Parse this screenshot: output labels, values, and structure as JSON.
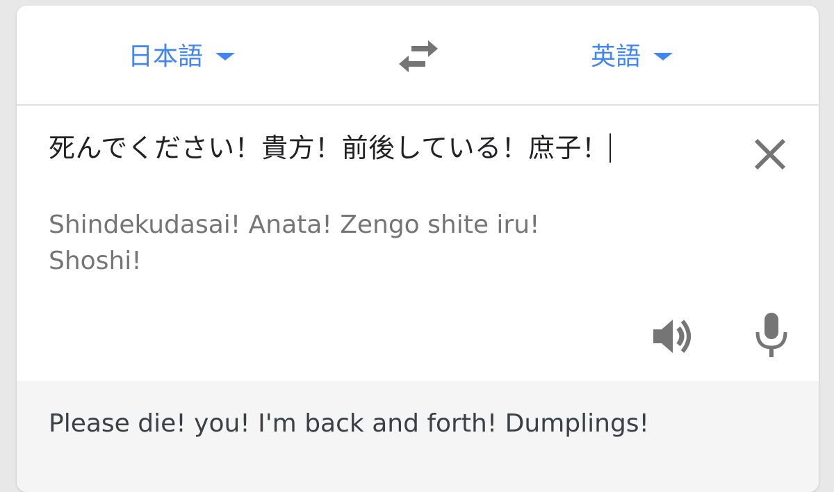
{
  "languages": {
    "source": "日本語",
    "target": "英語",
    "swap_icon": "swap-horiz-icon"
  },
  "input": {
    "text": "死んでください！貴方！前後している！庶子！",
    "romanization": "Shindekudasai! Anata! Zengo shite iru! Shoshi!",
    "clear_icon": "close-icon",
    "speaker_icon": "volume-icon",
    "mic_icon": "microphone-icon"
  },
  "output": {
    "translation": "Please die! you! I'm back and forth! Dumplings!"
  },
  "colors": {
    "accent": "#4285f4",
    "icon_gray": "#757575",
    "text": "#202124",
    "romaji": "#757575",
    "result_bg": "#f5f5f5"
  }
}
